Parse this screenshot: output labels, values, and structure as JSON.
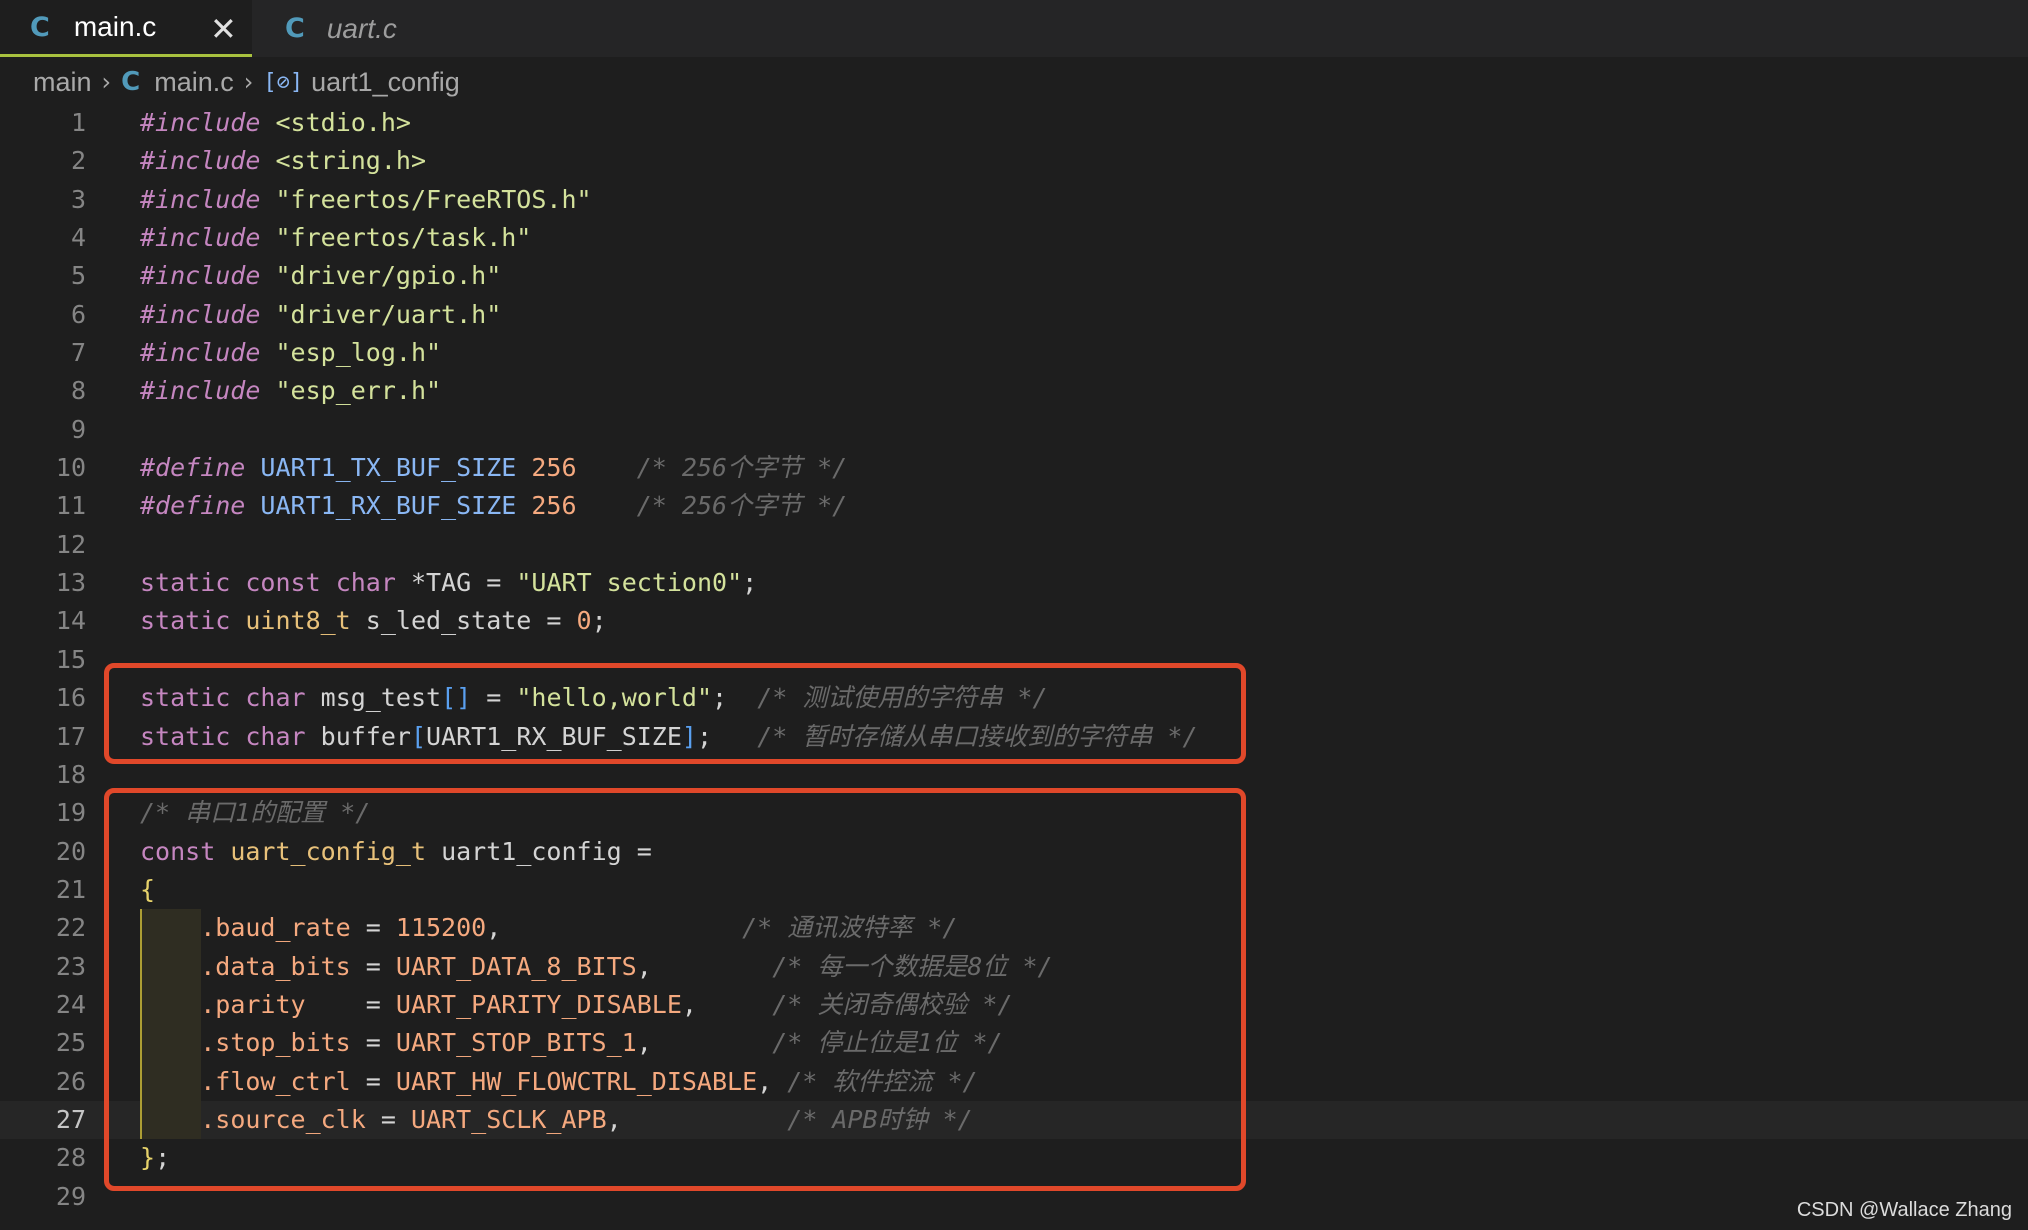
{
  "tabs": [
    {
      "label": "main.c",
      "icon": "c-file-icon",
      "active": true
    },
    {
      "label": "uart.c",
      "icon": "c-file-icon",
      "active": false
    }
  ],
  "breadcrumb": {
    "folder": "main",
    "file": "main.c",
    "symbol": "uart1_config"
  },
  "editor": {
    "current_line": 27,
    "lines": [
      {
        "n": "1"
      },
      {
        "n": "2"
      },
      {
        "n": "3"
      },
      {
        "n": "4"
      },
      {
        "n": "5"
      },
      {
        "n": "6"
      },
      {
        "n": "7"
      },
      {
        "n": "8"
      },
      {
        "n": "9"
      },
      {
        "n": "10"
      },
      {
        "n": "11"
      },
      {
        "n": "12"
      },
      {
        "n": "13"
      },
      {
        "n": "14"
      },
      {
        "n": "15"
      },
      {
        "n": "16"
      },
      {
        "n": "17"
      },
      {
        "n": "18"
      },
      {
        "n": "19"
      },
      {
        "n": "20"
      },
      {
        "n": "21"
      },
      {
        "n": "22"
      },
      {
        "n": "23"
      },
      {
        "n": "24"
      },
      {
        "n": "25"
      },
      {
        "n": "26"
      },
      {
        "n": "27"
      },
      {
        "n": "28"
      },
      {
        "n": "29"
      }
    ],
    "tokens": {
      "include": "#include",
      "define": "#define",
      "h1": "<stdio.h>",
      "h2": "<string.h>",
      "h3": "\"freertos/FreeRTOS.h\"",
      "h4": "\"freertos/task.h\"",
      "h5": "\"driver/gpio.h\"",
      "h6": "\"driver/uart.h\"",
      "h7": "\"esp_log.h\"",
      "h8": "\"esp_err.h\"",
      "tx_macro": "UART1_TX_BUF_SIZE",
      "rx_macro": "UART1_RX_BUF_SIZE",
      "buf_val": "256",
      "cmt_256": "/* 256个字节 */",
      "static": "static",
      "const": "const",
      "char": "char",
      "uint8": "uint8_t",
      "tag_decl": "*TAG",
      "eq": " = ",
      "tag_str": "\"UART section0\"",
      "semi": ";",
      "led_var": "s_led_state",
      "zero": "0",
      "msg_var": "msg_test",
      "brackets_empty": "[]",
      "msg_str": "\"hello,world\"",
      "cmt_msg": "/* 测试使用的字符串 */",
      "buf_var": "buffer",
      "lbr": "[",
      "rbr": "]",
      "cmt_buf": "/* 暂时存储从串口接收到的字符串 */",
      "cmt_cfg": "/* 串口1的配置 */",
      "cfg_type": "uart_config_t",
      "cfg_var": "uart1_config",
      "eq_end": " =",
      "lbrace": "{",
      "rbrace": "}",
      "f_baud": ".baud_rate",
      "v_baud": "115200",
      "cmt_baud": "/* 通讯波特率 */",
      "f_data": ".data_bits",
      "v_data": "UART_DATA_8_BITS",
      "cmt_data": "/* 每一个数据是8位 */",
      "f_parity": ".parity",
      "v_parity": "UART_PARITY_DISABLE",
      "cmt_parity": "/* 关闭奇偶校验 */",
      "f_stop": ".stop_bits",
      "v_stop": "UART_STOP_BITS_1",
      "cmt_stop": "/* 停止位是1位 */",
      "f_flow": ".flow_ctrl",
      "v_flow": "UART_HW_FLOWCTRL_DISABLE",
      "cmt_flow": "/* 软件控流 */",
      "f_clk": ".source_clk",
      "v_clk": "UART_SCLK_APB",
      "cmt_clk": "/* APB时钟 */",
      "comma": ","
    }
  },
  "watermark": "CSDN @Wallace Zhang",
  "colors": {
    "highlight_box": "#e0482a",
    "tab_active_underline": "#a9c23f"
  }
}
